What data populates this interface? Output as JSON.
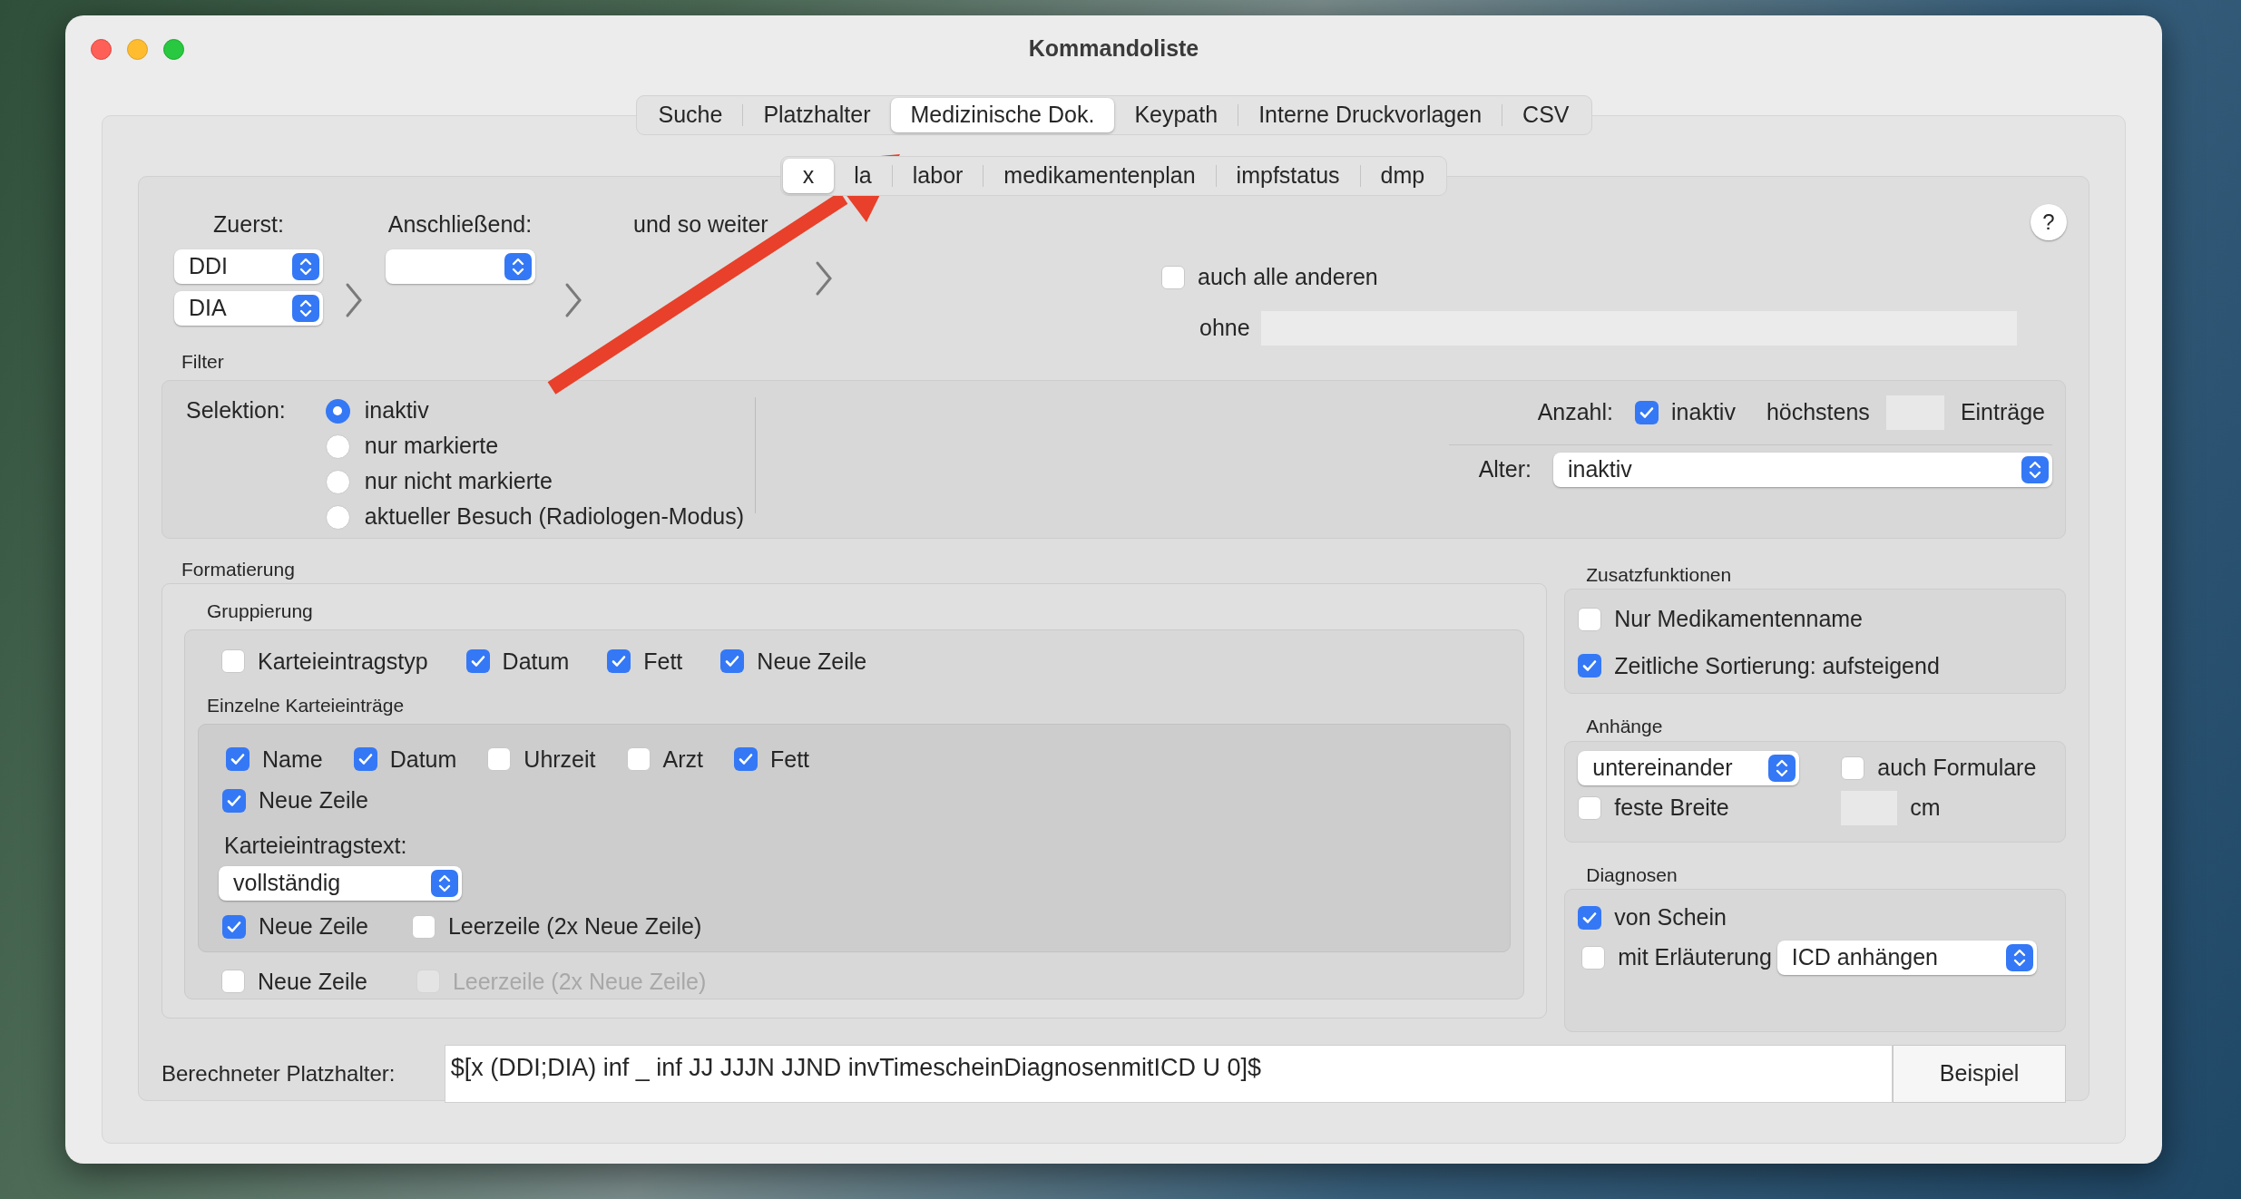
{
  "window": {
    "title": "Kommandoliste"
  },
  "main_tabs": [
    {
      "label": "Suche",
      "selected": false
    },
    {
      "label": "Platzhalter",
      "selected": false
    },
    {
      "label": "Medizinische Dok.",
      "selected": true
    },
    {
      "label": "Keypath",
      "selected": false
    },
    {
      "label": "Interne Druckvorlagen",
      "selected": false
    },
    {
      "label": "CSV",
      "selected": false
    }
  ],
  "sub_tabs": [
    {
      "label": "x",
      "selected": true
    },
    {
      "label": "la",
      "selected": false
    },
    {
      "label": "labor",
      "selected": false
    },
    {
      "label": "medikamentenplan",
      "selected": false
    },
    {
      "label": "impfstatus",
      "selected": false
    },
    {
      "label": "dmp",
      "selected": false
    }
  ],
  "sequence": {
    "first_label": "Zuerst:",
    "first_selects": [
      "DDI",
      "DIA"
    ],
    "next_label": "Anschließend:",
    "etc_label": "und so weiter"
  },
  "help_button": "?",
  "others": {
    "label": "auch alle anderen",
    "checked": false,
    "without_label": "ohne"
  },
  "filter": {
    "title": "Filter",
    "selection_label": "Selektion:",
    "options": [
      {
        "label": "inaktiv",
        "selected": true
      },
      {
        "label": "nur markierte",
        "selected": false
      },
      {
        "label": "nur nicht markierte",
        "selected": false
      },
      {
        "label": "aktueller Besuch (Radiologen-Modus)",
        "selected": false
      }
    ],
    "count_label": "Anzahl:",
    "count_checkbox": {
      "label": "inaktiv",
      "checked": true
    },
    "max_label": "höchstens",
    "entries_label": "Einträge",
    "age_label": "Alter:",
    "age_value": "inaktiv"
  },
  "formatting": {
    "title": "Formatierung",
    "grouping": {
      "title": "Gruppierung",
      "options": [
        {
          "label": "Karteieintragstyp",
          "checked": false
        },
        {
          "label": "Datum",
          "checked": true
        },
        {
          "label": "Fett",
          "checked": true
        },
        {
          "label": "Neue Zeile",
          "checked": true
        }
      ]
    },
    "single": {
      "title": "Einzelne Karteieinträge",
      "options": [
        {
          "label": "Name",
          "checked": true
        },
        {
          "label": "Datum",
          "checked": true
        },
        {
          "label": "Uhrzeit",
          "checked": false
        },
        {
          "label": "Arzt",
          "checked": false
        },
        {
          "label": "Fett",
          "checked": true
        }
      ],
      "newline": {
        "label": "Neue Zeile",
        "checked": true
      },
      "text_label": "Karteieintragstext:",
      "text_value": "vollständig",
      "text_options": [
        {
          "label": "Neue Zeile",
          "checked": true
        },
        {
          "label": "Leerzeile (2x Neue Zeile)",
          "checked": false
        }
      ]
    },
    "bottom_options": [
      {
        "label": "Neue Zeile",
        "checked": false,
        "disabled": false
      },
      {
        "label": "Leerzeile (2x Neue Zeile)",
        "checked": false,
        "disabled": true
      }
    ]
  },
  "extras": {
    "title": "Zusatzfunktionen",
    "options": [
      {
        "label": "Nur Medikamentenname",
        "checked": false
      },
      {
        "label": "Zeitliche Sortierung: aufsteigend",
        "checked": true
      }
    ]
  },
  "attachments": {
    "title": "Anhänge",
    "layout_value": "untereinander",
    "forms": {
      "label": "auch Formulare",
      "checked": false
    },
    "fixed_width": {
      "label": "feste Breite",
      "checked": false
    },
    "unit": "cm"
  },
  "diagnoses": {
    "title": "Diagnosen",
    "from_certificate": {
      "label": "von Schein",
      "checked": true
    },
    "with_explanation": {
      "label": "mit Erläuterung",
      "checked": false
    },
    "icd_value": "ICD anhängen"
  },
  "placeholder_row": {
    "label": "Berechneter Platzhalter:",
    "value": "$[x (DDI;DIA) inf _ inf JJ JJJN JJND invTimescheinDiagnosenmitICD U 0]$",
    "button": "Beispiel"
  }
}
